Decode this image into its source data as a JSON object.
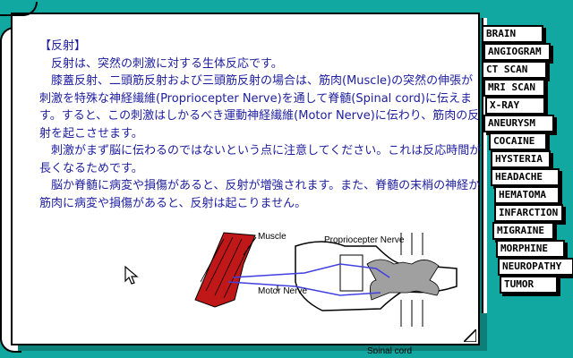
{
  "article": {
    "heading": "【反射】",
    "paragraphs": [
      "反射は、突然の刺激に対する生体反応です。",
      "膝蓋反射、二頭筋反射および三頭筋反射の場合は、筋肉(Muscle)の突然の伸張が刺激を特殊な神経繊維(Propriocepter Nerve)を通して脊髄(Spinal cord)に伝えます。すると、この刺激はしかるべき運動神経繊維(Motor Nerve)に伝わり、筋肉の反射を起こさせます。",
      "刺激がまず脳に伝わるのではないという点に注意してください。これは反応時間が長くなるためです。",
      "脳か脊髄に病変や損傷があると、反射が増強されます。また、脊髄の末梢の神経か筋肉に病変や損傷があると、反射は起こりません。"
    ]
  },
  "diagram": {
    "labels": {
      "muscle": "Muscle",
      "proprioceptor": "Propriocepter Nerve",
      "motor": "Motor Nerve",
      "spinal": "Spinal cord"
    },
    "colors": {
      "muscle": "#c01818",
      "nerve": "#4040e0",
      "gray_matter": "#a0a0a0"
    }
  },
  "tabs": [
    "BRAIN",
    "ANGIOGRAM",
    "CT SCAN",
    "MRI SCAN",
    "X-RAY",
    "ANEURYSM",
    "COCAINE",
    "HYSTERIA",
    "HEADACHE",
    "HEMATOMA",
    "INFARCTION",
    "MIGRAINE",
    "MORPHINE",
    "NEUROPATHY",
    "TUMOR"
  ],
  "colors": {
    "background": "#10a8a0",
    "text": "#2020a0"
  }
}
